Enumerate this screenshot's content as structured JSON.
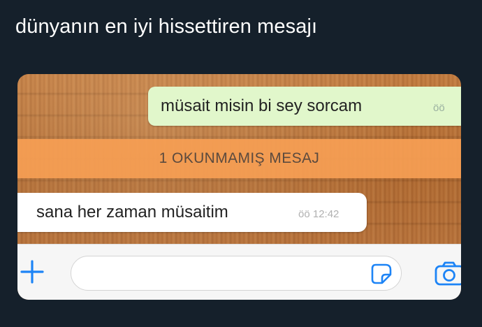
{
  "tweet": {
    "text": "dünyanın en iyi hissettiren mesajı"
  },
  "chat": {
    "outgoing_message": {
      "text": "müsait misin bi sey sorcam",
      "status": "öö"
    },
    "unread_banner": {
      "label": "1 OKUNMAMIŞ MESAJ"
    },
    "incoming_message": {
      "text": "sana her zaman müsaitim",
      "status": "öö",
      "time": "12:42"
    },
    "composer": {
      "input_value": "",
      "attach_icon": "plus-icon",
      "sticker_icon": "sticker-icon",
      "camera_icon": "camera-icon"
    }
  },
  "colors": {
    "page_background": "#15202b",
    "outgoing_bubble": "#e1f7cb",
    "incoming_bubble": "#ffffff",
    "unread_banner": "#f69e54",
    "accent_blue": "#1d84f6"
  }
}
